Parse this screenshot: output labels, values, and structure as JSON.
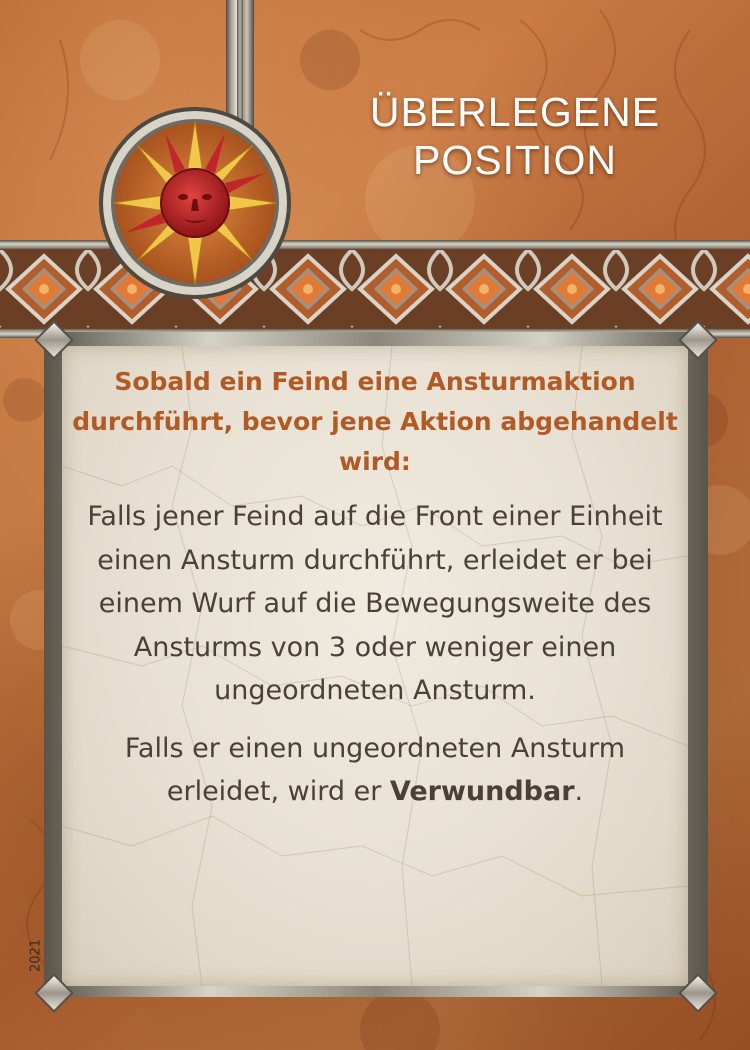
{
  "card": {
    "title_line1": "ÜBERLEGENE",
    "title_line2": "POSITION",
    "trigger_text": "Sobald ein Feind eine Ansturmaktion durchführt, bevor jene Aktion abgehandelt wird:",
    "effect_paragraph1": "Falls jener Feind auf die Front einer Einheit einen Ansturm durchführt, erleidet er bei einem Wurf auf die Bewegungsweite des Ansturms von 3 oder weniger einen ungeordneten Ansturm.",
    "effect_paragraph2_prefix": "Falls er einen ungeordneten Ansturm erleidet, wird er ",
    "effect_paragraph2_keyword": "Verwundbar",
    "effect_paragraph2_suffix": ".",
    "year": "2021",
    "emblem_icon": "sun-face-icon"
  },
  "colors": {
    "background": "#bf7040",
    "title": "#ffffff",
    "trigger": "#b25a26",
    "body": "#4b4038",
    "panel": "#ebe5d8",
    "sun": "#c0262a",
    "rays": "#f2c64a"
  }
}
